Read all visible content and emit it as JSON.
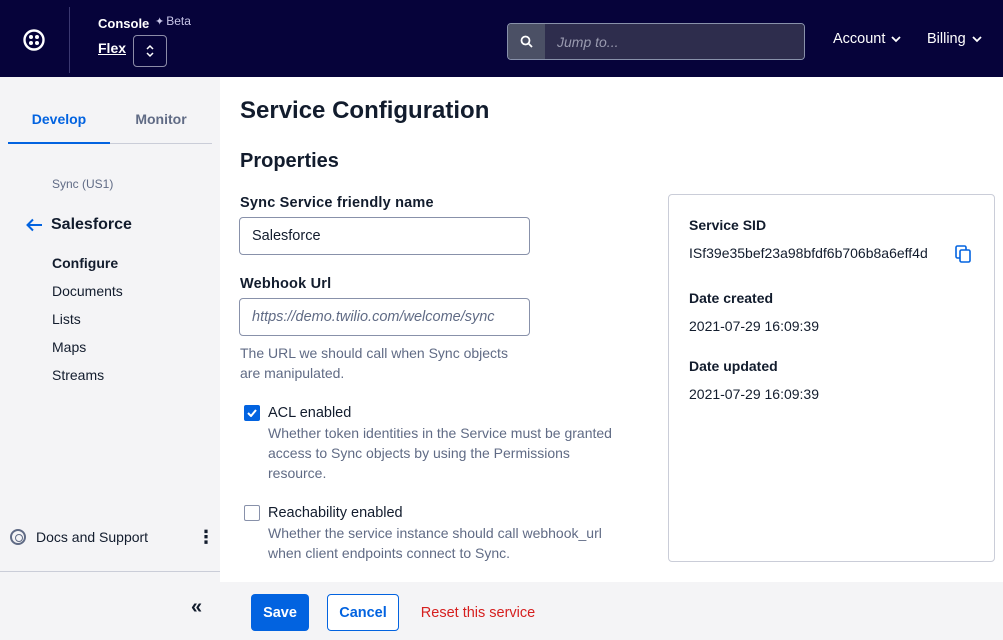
{
  "topbar": {
    "console_label": "Console",
    "beta_label": "Beta",
    "product_label": "Flex",
    "search_placeholder": "Jump to...",
    "nav": [
      {
        "label": "Account"
      },
      {
        "label": "Billing"
      }
    ]
  },
  "sidebar": {
    "tabs": [
      {
        "label": "Develop",
        "active": true
      },
      {
        "label": "Monitor",
        "active": false
      }
    ],
    "breadcrumb": "Sync (US1)",
    "section_title": "Salesforce",
    "items": [
      {
        "label": "Configure",
        "active": true
      },
      {
        "label": "Documents"
      },
      {
        "label": "Lists"
      },
      {
        "label": "Maps"
      },
      {
        "label": "Streams"
      }
    ],
    "docs_label": "Docs and Support"
  },
  "main": {
    "page_title": "Service Configuration",
    "section_title": "Properties",
    "friendly_name": {
      "label": "Sync Service friendly name",
      "value": "Salesforce"
    },
    "webhook": {
      "label": "Webhook Url",
      "placeholder": "https://demo.twilio.com/welcome/sync",
      "help": "The URL we should call when Sync objects are manipulated."
    },
    "acl": {
      "label": "ACL enabled",
      "checked": true,
      "help": "Whether token identities in the Service must be granted access to Sync objects by using the Permissions resource."
    },
    "reachability": {
      "label": "Reachability enabled",
      "checked": false,
      "help": "Whether the service instance should call webhook_url when client endpoints connect to Sync."
    }
  },
  "info": {
    "sid_label": "Service SID",
    "sid_value": "ISf39e35bef23a98bfdf6b706b8a6eff4d",
    "created_label": "Date created",
    "created_value": "2021-07-29 16:09:39",
    "updated_label": "Date updated",
    "updated_value": "2021-07-29 16:09:39"
  },
  "footer": {
    "save_label": "Save",
    "cancel_label": "Cancel",
    "reset_label": "Reset this service"
  },
  "colors": {
    "topbar_bg": "#06033a",
    "primary": "#0263e0",
    "danger": "#d61f1f",
    "sidebar_bg": "#f4f4f6"
  }
}
